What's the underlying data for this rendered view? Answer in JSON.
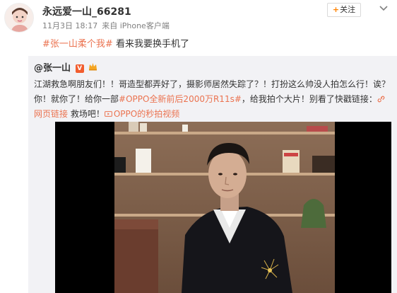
{
  "post": {
    "username": "永远爱一山_66281",
    "time": "11月3日 18:17",
    "source": "来自 iPhone客户端",
    "follow_label": "关注",
    "topic": "#张一山柔个我#",
    "text": "看来我要换手机了"
  },
  "repost": {
    "author": "@张一山",
    "body_1": "江湖救急啊朋友们！！哥造型都弄好了，摄影师居然失踪了？！打扮这么帅没人拍怎么行！诶？你！就你了！给你一部",
    "highlight": "#OPPO全新前后2000万R11s#",
    "body_2": "，给我拍个大片！别看了快戳链接：",
    "link_1": "网页链接",
    "body_3": " 救场吧！",
    "link_2": "OPPO的秒拍视频"
  },
  "icons": {
    "verified": "verified-v-icon",
    "crown": "crown-icon",
    "link": "link-icon",
    "video": "video-icon",
    "menu": "chevron-down-icon"
  },
  "colors": {
    "accent": "#eb7350",
    "verified": "#f25d2e",
    "follow_plus": "#ff8200"
  }
}
